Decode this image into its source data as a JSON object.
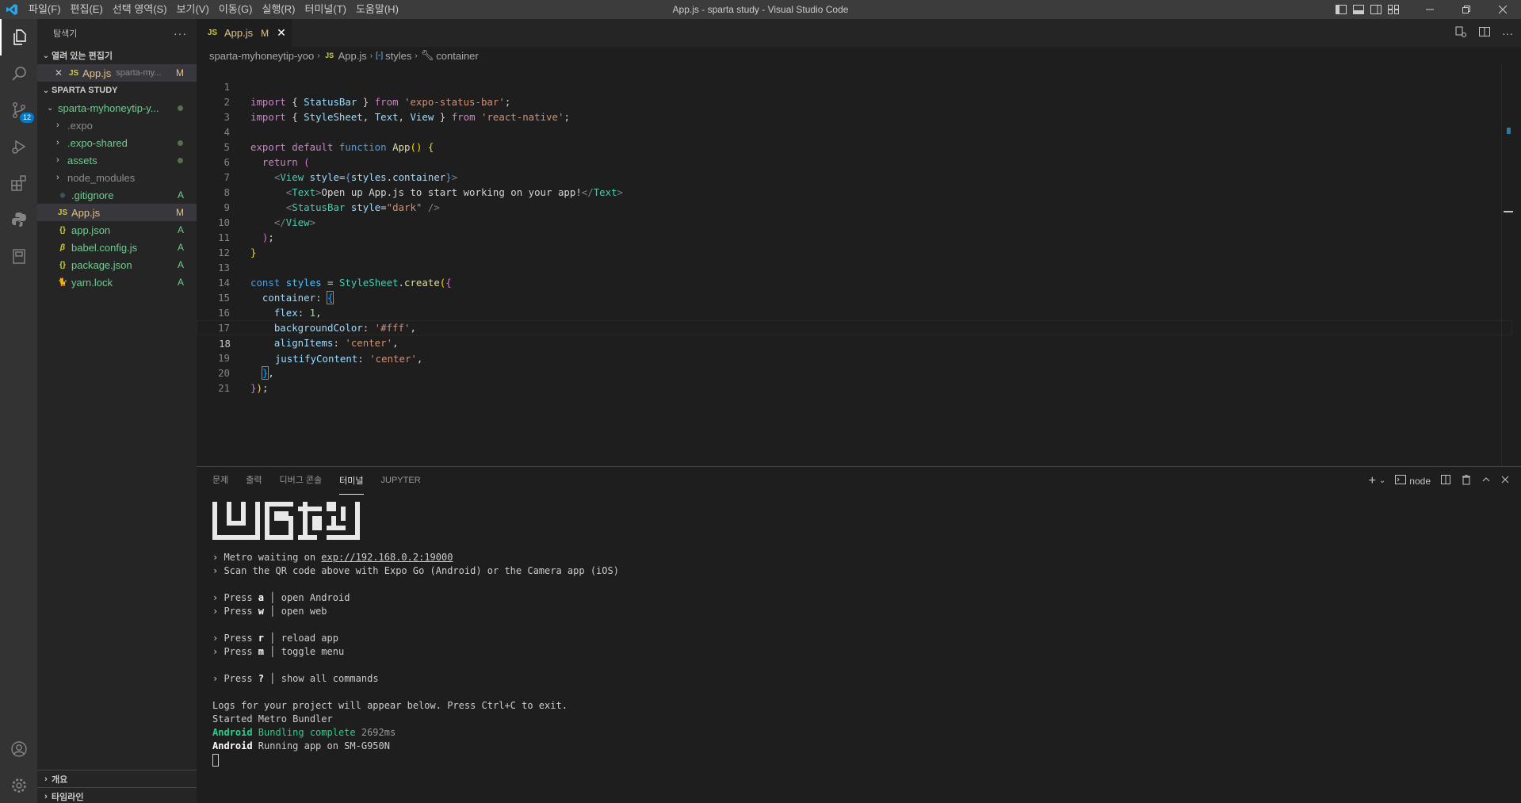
{
  "titlebar": {
    "title": "App.js - sparta study - Visual Studio Code",
    "menu": [
      "파일(F)",
      "편집(E)",
      "선택 영역(S)",
      "보기(V)",
      "이동(G)",
      "실행(R)",
      "터미널(T)",
      "도움말(H)"
    ],
    "accent": "#3c3c3c"
  },
  "activity": {
    "scm_badge": "12"
  },
  "sidebar": {
    "header": "탐색기",
    "open_editors_title": "열려 있는 편집기",
    "open_editor": {
      "name": "App.js",
      "path": "sparta-my...",
      "status": "M"
    },
    "workspace_title": "SPARTA STUDY",
    "root_folder": "sparta-myhoneytip-y...",
    "items": [
      {
        "name": ".expo",
        "kind": "folder",
        "status": ""
      },
      {
        "name": ".expo-shared",
        "kind": "folder",
        "status": "dot"
      },
      {
        "name": "assets",
        "kind": "folder",
        "status": "dot"
      },
      {
        "name": "node_modules",
        "kind": "folder",
        "status": ""
      },
      {
        "name": ".gitignore",
        "kind": "file",
        "status": "A"
      },
      {
        "name": "App.js",
        "kind": "file",
        "status": "M"
      },
      {
        "name": "app.json",
        "kind": "file",
        "status": "A"
      },
      {
        "name": "babel.config.js",
        "kind": "file",
        "status": "A"
      },
      {
        "name": "package.json",
        "kind": "file",
        "status": "A"
      },
      {
        "name": "yarn.lock",
        "kind": "file",
        "status": "A"
      }
    ],
    "outline_title": "개요",
    "timeline_title": "타임라인"
  },
  "tabs": [
    {
      "icon": "JS",
      "name": "App.js",
      "status": "M"
    }
  ],
  "breadcrumb": [
    "sparta-myhoneytip-yoo",
    "App.js",
    "styles",
    "container"
  ],
  "editor": {
    "line_numbers": [
      "1",
      "2",
      "3",
      "4",
      "5",
      "6",
      "7",
      "8",
      "9",
      "10",
      "11",
      "12",
      "13",
      "14",
      "15",
      "16",
      "17",
      "18",
      "19",
      "20",
      "21"
    ],
    "current_line": "18",
    "code": {
      "l1": [
        "import",
        " { ",
        "StatusBar",
        " } ",
        "from",
        " ",
        "'expo-status-bar'",
        ";"
      ],
      "l2": [
        "import",
        " { ",
        "StyleSheet",
        ", ",
        "Text",
        ", ",
        "View",
        " } ",
        "from",
        " ",
        "'react-native'",
        ";"
      ],
      "l4": [
        "export",
        " ",
        "default",
        " ",
        "function",
        " ",
        "App",
        "(",
        ")",
        " ",
        "{"
      ],
      "l5": [
        "  ",
        "return",
        " ",
        "("
      ],
      "l6": [
        "    ",
        "<",
        "View",
        " ",
        "style",
        "=",
        "{",
        "styles",
        ".",
        "container",
        "}",
        ">"
      ],
      "l7": [
        "      ",
        "<",
        "Text",
        ">",
        "Open up App.js to start working on your app!",
        "</",
        "Text",
        ">"
      ],
      "l8": [
        "      ",
        "<",
        "StatusBar",
        " ",
        "style",
        "=",
        "\"dark\"",
        " ",
        "/>"
      ],
      "l9": [
        "    ",
        "</",
        "View",
        ">"
      ],
      "l10": [
        "  ",
        ")",
        ";"
      ],
      "l11": [
        "}"
      ],
      "l13": [
        "const",
        " ",
        "styles",
        " = ",
        "StyleSheet",
        ".",
        "create",
        "(",
        "{"
      ],
      "l14": [
        "  ",
        "container",
        ": ",
        "{"
      ],
      "l15": [
        "    ",
        "flex",
        ": ",
        "1",
        ","
      ],
      "l16": [
        "    ",
        "backgroundColor",
        ": ",
        "'#fff'",
        ","
      ],
      "l17": [
        "    ",
        "alignItems",
        ": ",
        "'center'",
        ","
      ],
      "l18": [
        "    ",
        "justifyContent",
        ": ",
        "'center'",
        ","
      ],
      "l19": [
        "  ",
        "}",
        ","
      ],
      "l20": [
        "}",
        ")",
        ";"
      ]
    }
  },
  "panel": {
    "tabs": [
      "문제",
      "출력",
      "디버그 콘솔",
      "터미널",
      "JUPYTER"
    ],
    "active_tab": "터미널",
    "terminal_name": "node",
    "lines": {
      "metro_prefix": "› Metro waiting on ",
      "metro_url": "exp://192.168.0.2:19000",
      "scan": "› Scan the QR code above with Expo Go (Android) or the Camera app (iOS)",
      "press": "› Press ",
      "keys": [
        {
          "key": "a",
          "desc": "open Android"
        },
        {
          "key": "w",
          "desc": "open web"
        },
        {
          "key": "r",
          "desc": "reload app"
        },
        {
          "key": "m",
          "desc": "toggle menu"
        },
        {
          "key": "?",
          "desc": "show all commands"
        }
      ],
      "logs": "Logs for your project will appear below. Press Ctrl+C to exit.",
      "started": "Started Metro Bundler",
      "android": "Android",
      "bundling": " Bundling complete",
      "bundle_time": " 2692ms",
      "running": " Running app on SM-G950N"
    }
  }
}
